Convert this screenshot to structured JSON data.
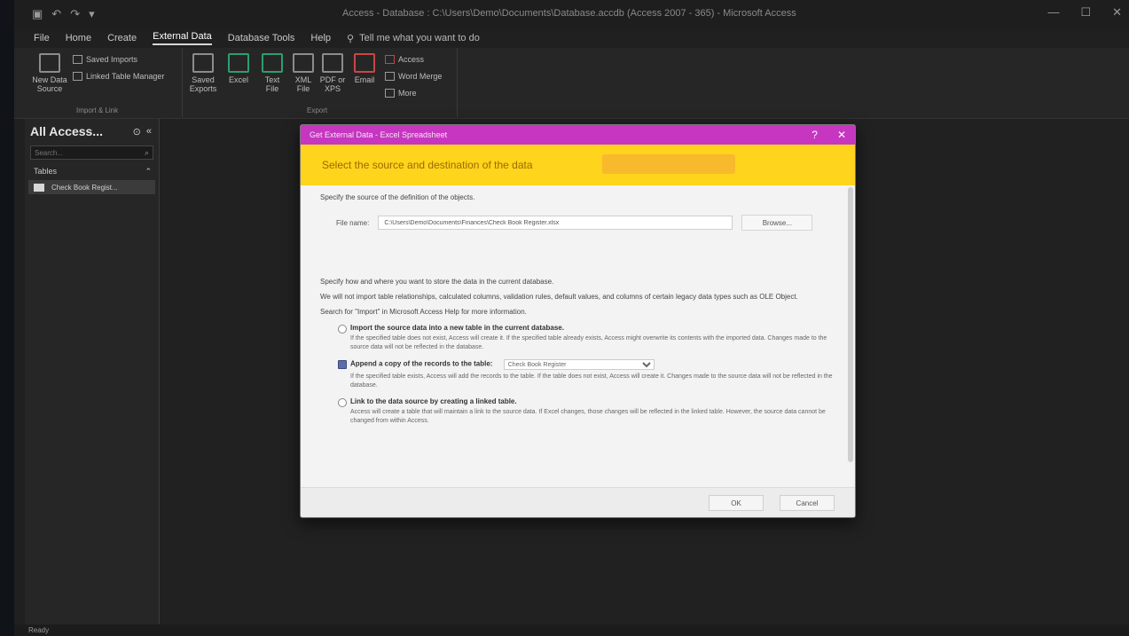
{
  "window": {
    "title": "Access - Database : C:\\Users\\Demo\\Documents\\Database.accdb (Access 2007 - 365) - Microsoft Access",
    "qat": [
      "save-icon",
      "undo-icon",
      "redo-icon"
    ],
    "controls": [
      "minimize-icon",
      "maximize-icon",
      "close-icon"
    ]
  },
  "ribbon": {
    "tabs": [
      "File",
      "Home",
      "Create",
      "External Data",
      "Database Tools",
      "Help"
    ],
    "active_tab": "External Data",
    "tell_me": "Tell me what you want to do",
    "import_link": {
      "new_source": "New Data Source",
      "saved_imports": "Saved Imports",
      "linked_table_manager": "Linked Table Manager",
      "group_label": "Import & Link"
    },
    "export": {
      "saved_exports": "Saved Exports",
      "excel": "Excel",
      "text_file": "Text File",
      "xml_file": "XML File",
      "pdf_xps": "PDF or XPS",
      "email": "Email",
      "access": "Access",
      "word_merge": "Word Merge",
      "more": "More",
      "group_label": "Export"
    }
  },
  "nav": {
    "title": "All Access...",
    "search_placeholder": "Search...",
    "group": "Tables",
    "items": [
      "Check Book Regist..."
    ]
  },
  "dialog": {
    "title": "Get External Data - Excel Spreadsheet",
    "heading": "Select the source and destination of the data",
    "source_prompt": "Specify the source of the definition of the objects.",
    "file_label": "File name:",
    "file_value": "C:\\Users\\Demo\\Documents\\Finances\\Check Book Register.xlsx",
    "browse": "Browse...",
    "dest_prompt": "Specify how and where you want to store the data in the current database.",
    "dest_note": "We will not import table relationships, calculated columns, validation rules, default values, and columns of certain legacy data types such as OLE Object.",
    "dest_note2": "Search for \"Import\" in Microsoft Access Help for more information.",
    "options": [
      {
        "label": "Import the source data into a new table in the current database.",
        "desc": "If the specified table does not exist, Access will create it. If the specified table already exists, Access might overwrite its contents with the imported data. Changes made to the source data will not be reflected in the database."
      },
      {
        "label": "Append a copy of the records to the table:",
        "select": "Check Book Register",
        "desc": "If the specified table exists, Access will add the records to the table. If the table does not exist, Access will create it. Changes made to the source data will not be reflected in the database."
      },
      {
        "label": "Link to the data source by creating a linked table.",
        "desc": "Access will create a table that will maintain a link to the source data. If Excel changes, those changes will be reflected in the linked table. However, the source data cannot be changed from within Access."
      }
    ],
    "ok": "OK",
    "cancel": "Cancel"
  },
  "status": "Ready"
}
